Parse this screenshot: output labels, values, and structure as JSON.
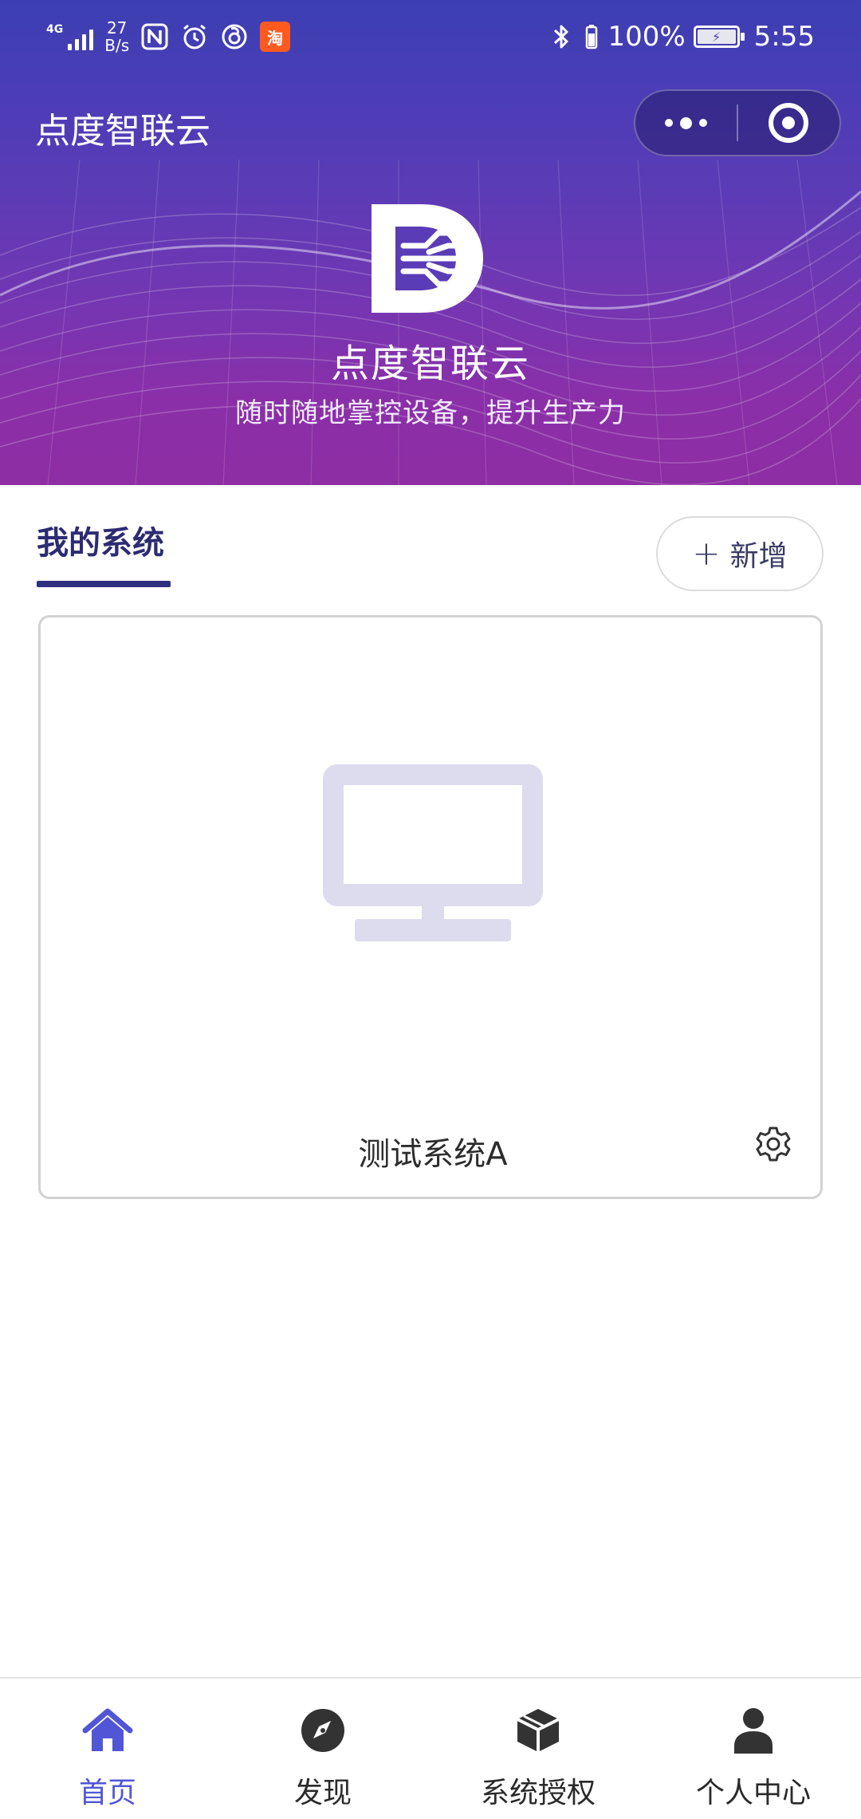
{
  "status_bar": {
    "network": "4G",
    "speed_value": "27",
    "speed_unit": "B/s",
    "taobao_label": "淘",
    "battery": "100%",
    "time": "5:55"
  },
  "nav": {
    "title": "点度智联云"
  },
  "hero": {
    "title": "点度智联云",
    "subtitle": "随时随地掌控设备，提升生产力"
  },
  "section": {
    "title": "我的系统",
    "add_label": "新增"
  },
  "systems": [
    {
      "name": "测试系统A"
    }
  ],
  "tabbar": {
    "items": [
      {
        "label": "首页",
        "icon": "home-icon",
        "active": true
      },
      {
        "label": "发现",
        "icon": "compass-icon",
        "active": false
      },
      {
        "label": "系统授权",
        "icon": "box-icon",
        "active": false
      },
      {
        "label": "个人中心",
        "icon": "person-icon",
        "active": false
      }
    ]
  },
  "colors": {
    "header_top": "#3c3fb2",
    "header_bottom": "#8e2ea4",
    "section_title": "#2c2c72",
    "active_tab": "#5156d6",
    "monitor_placeholder": "#dddbee"
  }
}
